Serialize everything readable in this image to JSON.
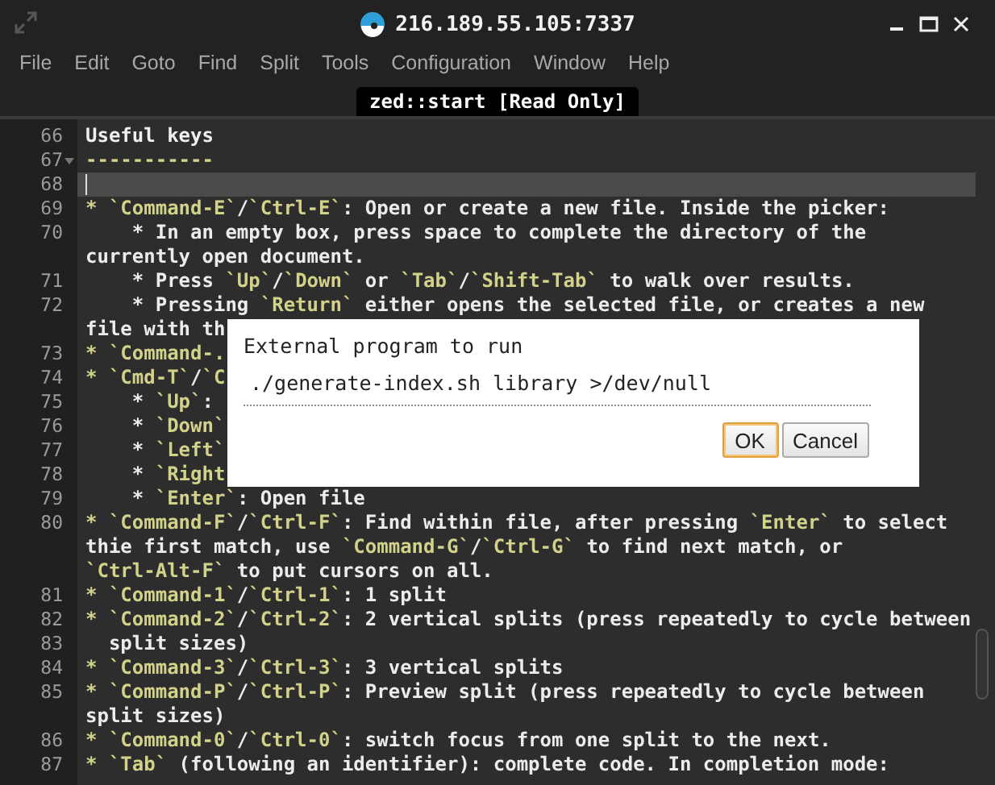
{
  "window": {
    "title": "216.189.55.105:7337"
  },
  "menu": [
    "File",
    "Edit",
    "Goto",
    "Find",
    "Split",
    "Tools",
    "Configuration",
    "Window",
    "Help"
  ],
  "tabs": [
    {
      "label": "zed::start [Read Only]",
      "selected": true
    }
  ],
  "editor": {
    "lines": [
      {
        "number": "66",
        "current": false,
        "foldable": false,
        "parts": [
          {
            "kind": "heading",
            "text": "Useful keys"
          }
        ]
      },
      {
        "number": "67",
        "current": false,
        "foldable": true,
        "parts": [
          {
            "kind": "code",
            "text": "-----------"
          }
        ]
      },
      {
        "number": "68",
        "current": true,
        "foldable": false
      },
      {
        "number": "69",
        "current": false,
        "foldable": false,
        "parts": [
          {
            "kind": "code",
            "text": "* `Command-E`"
          },
          {
            "kind": "plain",
            "text": "/"
          },
          {
            "kind": "code",
            "text": "`Ctrl-E`"
          },
          {
            "kind": "plain",
            "text": ": Open or create a new file. Inside the picker:"
          }
        ]
      },
      {
        "number": "70",
        "current": false,
        "foldable": false,
        "parts": [
          {
            "kind": "plain",
            "text": "    * In an empty box, press space to complete the directory of the"
          }
        ]
      },
      {
        "current": false,
        "foldable": false,
        "parts": [
          {
            "kind": "plain",
            "text": "currently open document."
          }
        ]
      },
      {
        "number": "71",
        "current": false,
        "foldable": false,
        "parts": [
          {
            "kind": "plain",
            "text": "    * Press "
          },
          {
            "kind": "code",
            "text": "`Up`"
          },
          {
            "kind": "plain",
            "text": "/"
          },
          {
            "kind": "code",
            "text": "`Down`"
          },
          {
            "kind": "plain",
            "text": " or "
          },
          {
            "kind": "code",
            "text": "`Tab`"
          },
          {
            "kind": "plain",
            "text": "/"
          },
          {
            "kind": "code",
            "text": "`Shift-Tab`"
          },
          {
            "kind": "plain",
            "text": " to walk over results."
          }
        ]
      },
      {
        "number": "72",
        "current": false,
        "foldable": false,
        "parts": [
          {
            "kind": "plain",
            "text": "    * Pressing "
          },
          {
            "kind": "code",
            "text": "`Return`"
          },
          {
            "kind": "plain",
            "text": " either opens the selected file, or creates a new"
          }
        ]
      },
      {
        "current": false,
        "foldable": false,
        "parts": [
          {
            "kind": "plain",
            "text": "file with th"
          }
        ]
      },
      {
        "number": "73",
        "current": false,
        "foldable": false,
        "parts": [
          {
            "kind": "code",
            "text": "* `Command-."
          }
        ]
      },
      {
        "number": "74",
        "current": false,
        "foldable": false,
        "parts": [
          {
            "kind": "code",
            "text": "* `Cmd-T`"
          },
          {
            "kind": "plain",
            "text": "/"
          },
          {
            "kind": "code",
            "text": "`C"
          }
        ]
      },
      {
        "number": "75",
        "current": false,
        "foldable": false,
        "parts": [
          {
            "kind": "plain",
            "text": "    * "
          },
          {
            "kind": "code",
            "text": "`Up`"
          },
          {
            "kind": "plain",
            "text": ":"
          }
        ]
      },
      {
        "number": "76",
        "current": false,
        "foldable": false,
        "parts": [
          {
            "kind": "plain",
            "text": "    * "
          },
          {
            "kind": "code",
            "text": "`Down`"
          }
        ]
      },
      {
        "number": "77",
        "current": false,
        "foldable": false,
        "parts": [
          {
            "kind": "plain",
            "text": "    * "
          },
          {
            "kind": "code",
            "text": "`Left`"
          }
        ]
      },
      {
        "number": "78",
        "current": false,
        "foldable": false,
        "parts": [
          {
            "kind": "plain",
            "text": "    * "
          },
          {
            "kind": "code",
            "text": "`Right"
          }
        ]
      },
      {
        "number": "79",
        "current": false,
        "foldable": false,
        "parts": [
          {
            "kind": "plain",
            "text": "    * "
          },
          {
            "kind": "code",
            "text": "`Enter`"
          },
          {
            "kind": "plain",
            "text": ": Open file"
          }
        ]
      },
      {
        "number": "80",
        "current": false,
        "foldable": false,
        "parts": [
          {
            "kind": "code",
            "text": "* `Command-F`"
          },
          {
            "kind": "plain",
            "text": "/"
          },
          {
            "kind": "code",
            "text": "`Ctrl-F`"
          },
          {
            "kind": "plain",
            "text": ": Find within file, after pressing "
          },
          {
            "kind": "code",
            "text": "`Enter`"
          },
          {
            "kind": "plain",
            "text": " to select"
          }
        ]
      },
      {
        "current": false,
        "foldable": false,
        "parts": [
          {
            "kind": "plain",
            "text": "thie first match, use "
          },
          {
            "kind": "code",
            "text": "`Command-G`"
          },
          {
            "kind": "plain",
            "text": "/"
          },
          {
            "kind": "code",
            "text": "`Ctrl-G`"
          },
          {
            "kind": "plain",
            "text": " to find next match, or"
          }
        ]
      },
      {
        "current": false,
        "foldable": false,
        "parts": [
          {
            "kind": "code",
            "text": "`Ctrl-Alt-F`"
          },
          {
            "kind": "plain",
            "text": " to put cursors on all."
          }
        ]
      },
      {
        "number": "81",
        "current": false,
        "foldable": false,
        "parts": [
          {
            "kind": "code",
            "text": "* `Command-1`"
          },
          {
            "kind": "plain",
            "text": "/"
          },
          {
            "kind": "code",
            "text": "`Ctrl-1`"
          },
          {
            "kind": "plain",
            "text": ": 1 split"
          }
        ]
      },
      {
        "number": "82",
        "current": false,
        "foldable": false,
        "parts": [
          {
            "kind": "code",
            "text": "* `Command-2`"
          },
          {
            "kind": "plain",
            "text": "/"
          },
          {
            "kind": "code",
            "text": "`Ctrl-2`"
          },
          {
            "kind": "plain",
            "text": ": 2 vertical splits (press repeatedly to cycle between"
          }
        ]
      },
      {
        "number": "83",
        "current": false,
        "foldable": false,
        "parts": [
          {
            "kind": "plain",
            "text": "  split sizes)"
          }
        ]
      },
      {
        "number": "84",
        "current": false,
        "foldable": false,
        "parts": [
          {
            "kind": "code",
            "text": "* `Command-3`"
          },
          {
            "kind": "plain",
            "text": "/"
          },
          {
            "kind": "code",
            "text": "`Ctrl-3`"
          },
          {
            "kind": "plain",
            "text": ": 3 vertical splits"
          }
        ]
      },
      {
        "number": "85",
        "current": false,
        "foldable": false,
        "parts": [
          {
            "kind": "code",
            "text": "* `Command-P`"
          },
          {
            "kind": "plain",
            "text": "/"
          },
          {
            "kind": "code",
            "text": "`Ctrl-P`"
          },
          {
            "kind": "plain",
            "text": ": Preview split (press repeatedly to cycle between"
          }
        ]
      },
      {
        "current": false,
        "foldable": false,
        "parts": [
          {
            "kind": "plain",
            "text": "split sizes)"
          }
        ]
      },
      {
        "number": "86",
        "current": false,
        "foldable": false,
        "parts": [
          {
            "kind": "code",
            "text": "* `Command-0`"
          },
          {
            "kind": "plain",
            "text": "/"
          },
          {
            "kind": "code",
            "text": "`Ctrl-0`"
          },
          {
            "kind": "plain",
            "text": ": switch focus from one split to the next."
          }
        ]
      },
      {
        "number": "87",
        "current": false,
        "foldable": false,
        "parts": [
          {
            "kind": "code",
            "text": "* `Tab`"
          },
          {
            "kind": "plain",
            "text": " (following an identifier): complete code. In completion mode:"
          }
        ]
      }
    ]
  },
  "dialog": {
    "title": "External program to run",
    "value": "./generate-index.sh library >/dev/null",
    "buttons": [
      {
        "label": "OK",
        "focused": true
      },
      {
        "label": "Cancel",
        "focused": false
      }
    ]
  }
}
